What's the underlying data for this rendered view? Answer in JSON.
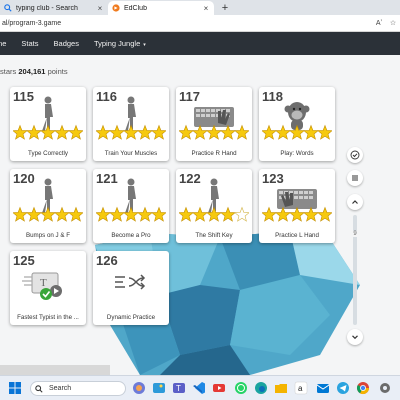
{
  "browser": {
    "tabs": [
      {
        "title": "typing club - Search",
        "icon": "search-icon",
        "close": "×"
      },
      {
        "title": "EdClub",
        "icon": "edclub-logo-icon",
        "close": "×"
      }
    ],
    "new_tab": "+",
    "url": "al/program-3.game",
    "reader_icon": "Aʼ",
    "favorite_icon": "☆"
  },
  "navbar": {
    "items": [
      {
        "label": "me"
      },
      {
        "label": "Stats"
      },
      {
        "label": "Badges"
      },
      {
        "label": "Typing Jungle"
      }
    ],
    "dropdown_caret": "▾"
  },
  "summary": {
    "stars_text": "stars",
    "points_value": "204,161",
    "points_text": "points"
  },
  "lessons": [
    {
      "number": "115",
      "label": "Type Correctly",
      "stars": 5,
      "icon": "walking-person-icon"
    },
    {
      "number": "116",
      "label": "Train Your Muscles",
      "stars": 5,
      "icon": "walking-person-icon"
    },
    {
      "number": "117",
      "label": "Practice R Hand",
      "stars": 5,
      "icon": "keyboard-hand-icon"
    },
    {
      "number": "118",
      "label": "Play: Words",
      "stars": 5,
      "icon": "monkey-game-icon"
    },
    {
      "number": "120",
      "label": "Bumps on J & F",
      "stars": 5,
      "icon": "walking-person-icon"
    },
    {
      "number": "121",
      "label": "Become a Pro",
      "stars": 5,
      "icon": "walking-person-icon"
    },
    {
      "number": "122",
      "label": "The Shift Key",
      "stars": 4,
      "icon": "walking-person-icon"
    },
    {
      "number": "123",
      "label": "Practice L Hand",
      "stars": 5,
      "icon": "keyboard-hand-icon"
    },
    {
      "number": "125",
      "label": "Fastest Typist in the ...",
      "stars": 0,
      "icon": "typing-test-icon"
    },
    {
      "number": "126",
      "label": "Dynamic Practice",
      "stars": 0,
      "icon": "shuffle-icon"
    }
  ],
  "sidebar": {
    "level_number": "9",
    "buttons": [
      "check-icon",
      "menu-icon",
      "chevron-up-icon",
      "chevron-down-icon"
    ]
  },
  "taskbar": {
    "search_label": "Search",
    "icons": [
      "windows-start-icon",
      "taskbar-search-icon",
      "copilot-icon",
      "photos-icon",
      "teams-icon",
      "vscode-icon",
      "youtube-icon",
      "whatsapp-icon",
      "edge-icon",
      "files-icon",
      "amazon-icon",
      "mail-icon",
      "telegram-icon",
      "chrome-icon",
      "settings-icon"
    ]
  },
  "colors": {
    "navbar": "#2b3138",
    "star_gold": "#f6c90e",
    "star_outline": "#c48f00",
    "check_green": "#3aa53a",
    "ice_blue": "#4aa6c7"
  }
}
